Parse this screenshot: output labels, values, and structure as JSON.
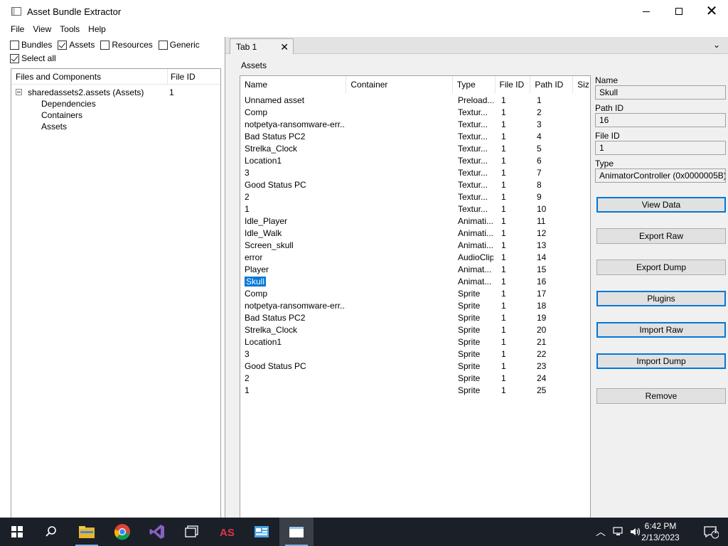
{
  "window": {
    "title": "Asset Bundle Extractor"
  },
  "menu": [
    "File",
    "View",
    "Tools",
    "Help"
  ],
  "filters": [
    {
      "label": "Bundles",
      "checked": false
    },
    {
      "label": "Assets",
      "checked": true
    },
    {
      "label": "Resources",
      "checked": false
    },
    {
      "label": "Generic",
      "checked": false
    }
  ],
  "select_all": {
    "label": "Select all",
    "checked": true
  },
  "tree": {
    "headers": [
      "Files and Components",
      "File ID"
    ],
    "root": {
      "label": "sharedassets2.assets (Assets)",
      "file_id": "1"
    },
    "children": [
      "Dependencies",
      "Containers",
      "Assets"
    ]
  },
  "tab": {
    "label": "Tab 1",
    "close": "✕",
    "menu_glyph": "⌄"
  },
  "assets_label": "Assets",
  "list": {
    "headers": [
      "Name",
      "Container",
      "Type",
      "File ID",
      "Path ID",
      "Siz"
    ],
    "rows": [
      {
        "name": "Unnamed asset",
        "container": "",
        "type": "Preload...",
        "file_id": "1",
        "path_id": "1"
      },
      {
        "name": "Comp",
        "container": "",
        "type": "Textur...",
        "file_id": "1",
        "path_id": "2"
      },
      {
        "name": "notpetya-ransomware-err...",
        "container": "",
        "type": "Textur...",
        "file_id": "1",
        "path_id": "3"
      },
      {
        "name": "Bad Status PC2",
        "container": "",
        "type": "Textur...",
        "file_id": "1",
        "path_id": "4"
      },
      {
        "name": "Strelka_Clock",
        "container": "",
        "type": "Textur...",
        "file_id": "1",
        "path_id": "5"
      },
      {
        "name": "Location1",
        "container": "",
        "type": "Textur...",
        "file_id": "1",
        "path_id": "6"
      },
      {
        "name": "3",
        "container": "",
        "type": "Textur...",
        "file_id": "1",
        "path_id": "7"
      },
      {
        "name": "Good Status PC",
        "container": "",
        "type": "Textur...",
        "file_id": "1",
        "path_id": "8"
      },
      {
        "name": "2",
        "container": "",
        "type": "Textur...",
        "file_id": "1",
        "path_id": "9"
      },
      {
        "name": "1",
        "container": "",
        "type": "Textur...",
        "file_id": "1",
        "path_id": "10"
      },
      {
        "name": "Idle_Player",
        "container": "",
        "type": "Animati...",
        "file_id": "1",
        "path_id": "11"
      },
      {
        "name": "Idle_Walk",
        "container": "",
        "type": "Animati...",
        "file_id": "1",
        "path_id": "12"
      },
      {
        "name": "Screen_skull",
        "container": "",
        "type": "Animati...",
        "file_id": "1",
        "path_id": "13"
      },
      {
        "name": "error",
        "container": "",
        "type": "AudioClip",
        "file_id": "1",
        "path_id": "14"
      },
      {
        "name": "Player",
        "container": "",
        "type": "Animat...",
        "file_id": "1",
        "path_id": "15"
      },
      {
        "name": "Skull",
        "container": "",
        "type": "Animat...",
        "file_id": "1",
        "path_id": "16",
        "selected": true
      },
      {
        "name": "Comp",
        "container": "",
        "type": "Sprite",
        "file_id": "1",
        "path_id": "17"
      },
      {
        "name": "notpetya-ransomware-err...",
        "container": "",
        "type": "Sprite",
        "file_id": "1",
        "path_id": "18"
      },
      {
        "name": "Bad Status PC2",
        "container": "",
        "type": "Sprite",
        "file_id": "1",
        "path_id": "19"
      },
      {
        "name": "Strelka_Clock",
        "container": "",
        "type": "Sprite",
        "file_id": "1",
        "path_id": "20"
      },
      {
        "name": "Location1",
        "container": "",
        "type": "Sprite",
        "file_id": "1",
        "path_id": "21"
      },
      {
        "name": "3",
        "container": "",
        "type": "Sprite",
        "file_id": "1",
        "path_id": "22"
      },
      {
        "name": "Good Status PC",
        "container": "",
        "type": "Sprite",
        "file_id": "1",
        "path_id": "23"
      },
      {
        "name": "2",
        "container": "",
        "type": "Sprite",
        "file_id": "1",
        "path_id": "24"
      },
      {
        "name": "1",
        "container": "",
        "type": "Sprite",
        "file_id": "1",
        "path_id": "25"
      }
    ]
  },
  "info": {
    "name_label": "Name",
    "name_value": "Skull",
    "path_id_label": "Path ID",
    "path_id_value": "16",
    "file_id_label": "File ID",
    "file_id_value": "1",
    "type_label": "Type",
    "type_value": "AnimatorController (0x0000005B)"
  },
  "buttons": [
    {
      "label": "View Data",
      "focus": true
    },
    {
      "label": "Export Raw",
      "focus": false
    },
    {
      "label": "Export Dump",
      "focus": false
    },
    {
      "label": "Plugins",
      "focus": true
    },
    {
      "label": "Import Raw",
      "focus": true
    },
    {
      "label": "Import Dump",
      "focus": true
    },
    {
      "label": "Remove",
      "focus": false
    }
  ],
  "taskbar": {
    "time": "6:42 PM",
    "date": "2/13/2023",
    "notification_count": "1",
    "apps": [
      "start-icon",
      "search-icon",
      "file-explorer-icon",
      "chrome-icon",
      "visual-studio-icon",
      "task-view-icon",
      "asset-studio-icon",
      "control-panel-icon",
      "asset-bundle-extractor-icon"
    ]
  },
  "colors": {
    "selection": "#0078d7",
    "taskbar": "#1b1f27",
    "focus_border": "#0078d7"
  }
}
